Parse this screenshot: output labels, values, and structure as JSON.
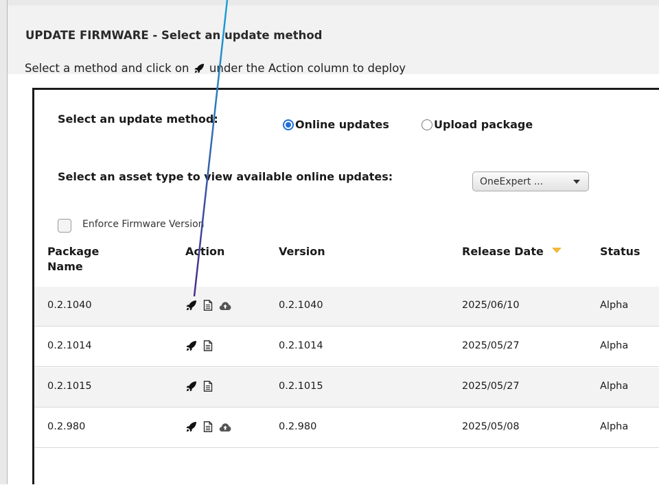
{
  "page": {
    "title": "UPDATE FIRMWARE - Select an update method",
    "instruction_before": "Select a method and click on",
    "instruction_after": "under the Action column to deploy"
  },
  "method": {
    "label": "Select an update method:",
    "options": [
      {
        "label": "Online updates",
        "selected": true
      },
      {
        "label": "Upload package",
        "selected": false
      }
    ]
  },
  "asset": {
    "label": "Select an asset type to view available online updates:",
    "selected": "OneExpert ..."
  },
  "enforce": {
    "label": "Enforce Firmware Version",
    "checked": false
  },
  "table": {
    "headers": {
      "package_name_1": "Package",
      "package_name_2": "Name",
      "action": "Action",
      "version": "Version",
      "release_date": "Release Date",
      "status": "Status"
    },
    "rows": [
      {
        "package": "0.2.1040",
        "version": "0.2.1040",
        "date": "2025/06/10",
        "status": "Alpha",
        "icons": [
          "rocket-icon",
          "document-icon",
          "cloud-upload-icon"
        ]
      },
      {
        "package": "0.2.1014",
        "version": "0.2.1014",
        "date": "2025/05/27",
        "status": "Alpha",
        "icons": [
          "rocket-icon",
          "document-icon"
        ]
      },
      {
        "package": "0.2.1015",
        "version": "0.2.1015",
        "date": "2025/05/27",
        "status": "Alpha",
        "icons": [
          "rocket-icon",
          "document-icon"
        ]
      },
      {
        "package": "0.2.980",
        "version": "0.2.980",
        "date": "2025/05/08",
        "status": "Alpha",
        "icons": [
          "rocket-icon",
          "document-icon",
          "cloud-upload-icon"
        ]
      }
    ]
  },
  "colors": {
    "radio_accent": "#1e6fd9",
    "sort_caret": "#f0b93a",
    "annotation_arrow_start": "#1aa3d9",
    "annotation_arrow_end": "#4a2a8a"
  }
}
